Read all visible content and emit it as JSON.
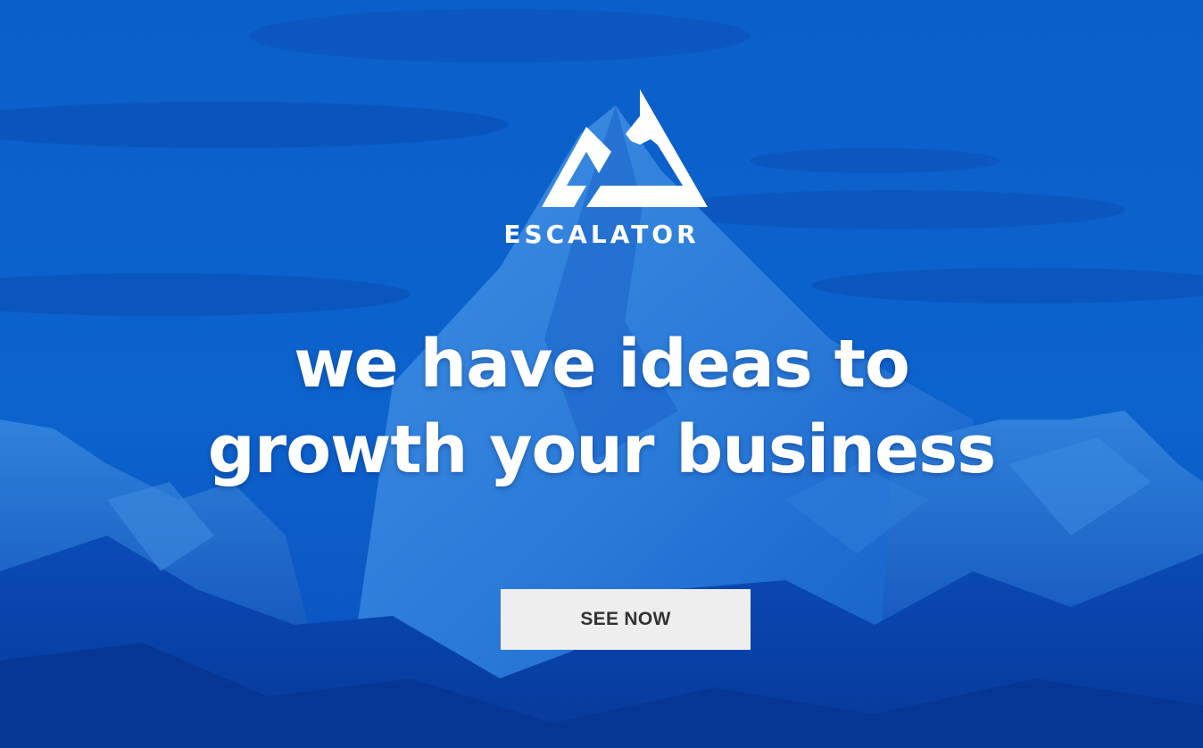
{
  "hero": {
    "brand_name": "ESCALATOR",
    "logo_icon": "mountain-logo-icon",
    "headline_line1": "we have ideas to",
    "headline_line2": "growth your business",
    "cta_label": "SEE NOW",
    "background_image": "blue-tinted mountain peak",
    "colors": {
      "overlay": "#0a55c8",
      "text": "#ffffff",
      "button_bg": "#eeeeee",
      "button_text": "#333333"
    }
  }
}
